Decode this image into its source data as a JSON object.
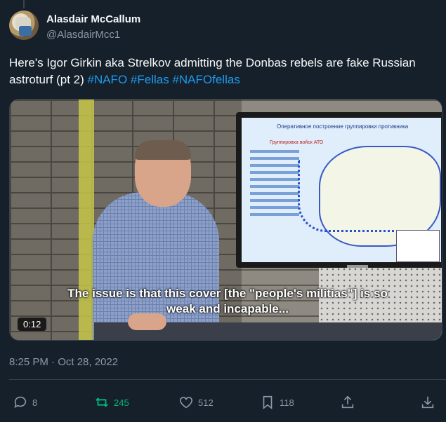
{
  "author": {
    "name": "Alasdair McCallum",
    "handle": "@AlasdairMcc1"
  },
  "tweet": {
    "text_main": "Here's Igor Girkin aka Strelkov admitting the Donbas rebels are fake Russian astroturf (pt 2) ",
    "hashtags": [
      "#NAFO",
      "#Fellas",
      "#NAFOfellas"
    ]
  },
  "video": {
    "subtitle": "The issue is that this cover [the \"people's militias\"] is so weak and incapable...",
    "duration": "0:12",
    "screen_title": "Оперативное построение группировки противника",
    "screen_subtitle": "Группировка войск АТО"
  },
  "meta": {
    "posted_at": "8:25 PM · Oct 28, 2022"
  },
  "actions": {
    "replies": "8",
    "retweets": "245",
    "likes": "512",
    "bookmarks": "118"
  },
  "colors": {
    "background": "#15202b",
    "text": "#f7f9f9",
    "secondary": "#8b98a5",
    "link": "#1d9bf0",
    "retweet": "#00ba7c"
  }
}
